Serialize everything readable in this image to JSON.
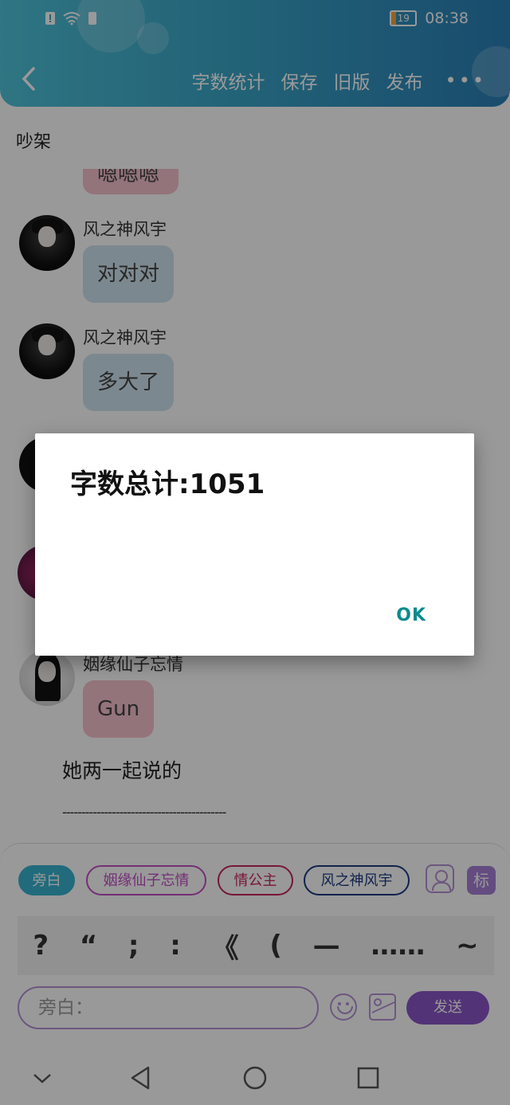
{
  "status_bar": {
    "battery": "19",
    "time": "08:38"
  },
  "header": {
    "nav": [
      "字数统计",
      "保存",
      "旧版",
      "发布"
    ],
    "more": "•••"
  },
  "chat": {
    "title": "吵架",
    "top_partial_text": "嗯嗯嗯",
    "messages": [
      {
        "sender": "风之神风宇",
        "text": "对对对"
      },
      {
        "sender": "风之神风宇",
        "text": "多大了"
      },
      {
        "sender": "姻缘仙子忘情",
        "text": "Gun"
      }
    ],
    "narration": "她两一起说的",
    "divider": "-------------------------------------------"
  },
  "input_panel": {
    "chips": [
      "旁白",
      "姻缘仙子忘情",
      "情公主",
      "风之神风宇"
    ],
    "tag_label": "标",
    "punctuation": [
      "?",
      "“",
      ";",
      ":",
      "《",
      "(",
      "—",
      "……",
      "~"
    ],
    "input_placeholder": "旁白：",
    "send_label": "发送"
  },
  "dialog": {
    "message": "字数总计:1051",
    "ok_label": "OK"
  },
  "colors": {
    "header_start": "#4fc3d9",
    "header_end": "#2a7fb6",
    "accent_purple": "#8a55c7",
    "dialog_ok": "#0b8a8e"
  }
}
